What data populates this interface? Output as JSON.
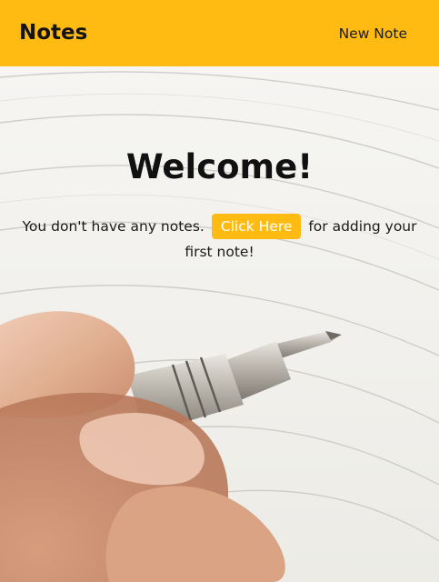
{
  "navbar": {
    "brand": "Notes",
    "new_note_label": "New Note"
  },
  "welcome": {
    "title": "Welcome!",
    "message_before": "You don't have any notes.",
    "cta_label": "Click Here",
    "message_after": "for adding your first note!"
  },
  "colors": {
    "accent": "#ffbb12",
    "cta_text": "#ffffff",
    "text": "#111111"
  }
}
